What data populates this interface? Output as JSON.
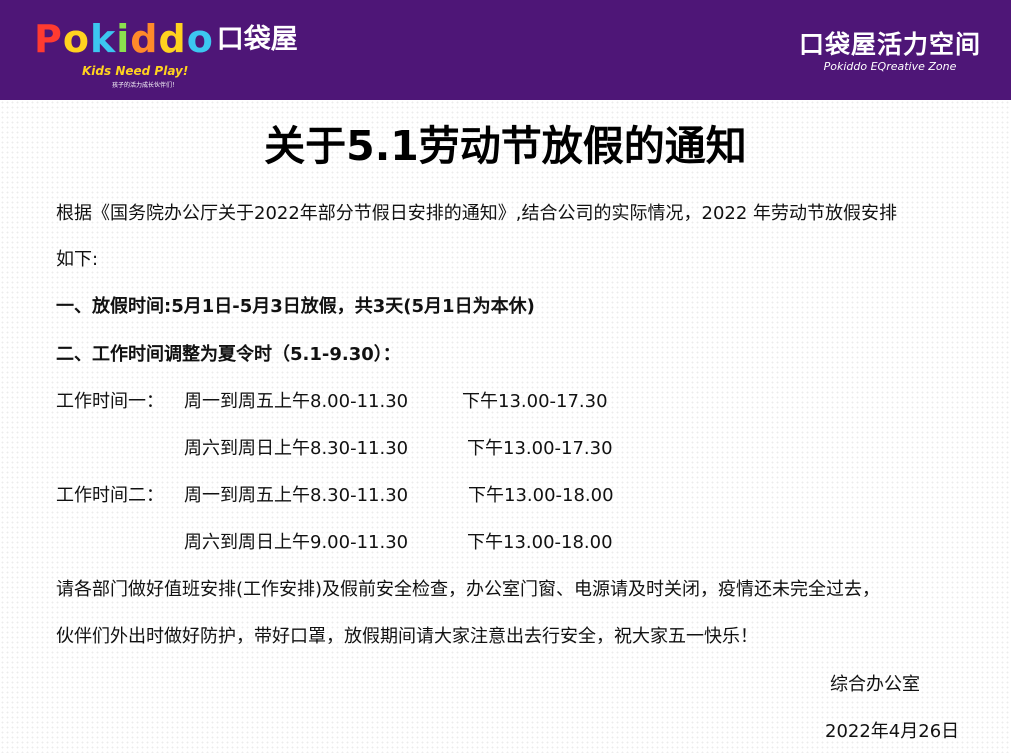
{
  "header": {
    "logo_text": "Pokiddo",
    "logo_chinese": "口袋屋",
    "logo_slogan": "Kids Need Play!",
    "logo_subtext": "孩子的活力成长伙伴们！",
    "brand_right_cn": "口袋屋活力空间",
    "brand_right_en": "Pokiddo EQreative Zone"
  },
  "notice": {
    "title": "关于5.1劳动节放假的通知",
    "intro_line1": "根据《国务院办公厅关于2022年部分节假日安排的通知》,结合公司的实际情况，2022 年劳动节放假安排",
    "intro_line2": "如下:",
    "item1": "一、放假时间:5月1日-5月3日放假，共3天(5月1日为本休)",
    "item2": "二、工作时间调整为夏令时（5.1-9.30）：",
    "schedule1": {
      "label": "工作时间一：",
      "rows": [
        {
          "am": "周一到周五上午8.00-11.30",
          "pm": "下午13.00-17.30"
        },
        {
          "am": "周六到周日上午8.30-11.30",
          "pm": "下午13.00-17.30"
        }
      ]
    },
    "schedule2": {
      "label": "工作时间二：",
      "rows": [
        {
          "am": "周一到周五上午8.30-11.30",
          "pm": "下午13.00-18.00"
        },
        {
          "am": "周六到周日上午9.00-11.30",
          "pm": "下午13.00-18.00"
        }
      ]
    },
    "closing_line1": "请各部门做好值班安排(工作安排)及假前安全检查，办公室门窗、电源请及时关闭，疫情还未完全过去，",
    "closing_line2": "伙伴们外出时做好防护，带好口罩，放假期间请大家注意出去行安全，祝大家五一快乐！",
    "signature": "综合办公室",
    "date": "2022年4月26日"
  },
  "colors": {
    "header_bg": "#4e1677",
    "slogan": "#ffd21f",
    "text": "#111111"
  }
}
